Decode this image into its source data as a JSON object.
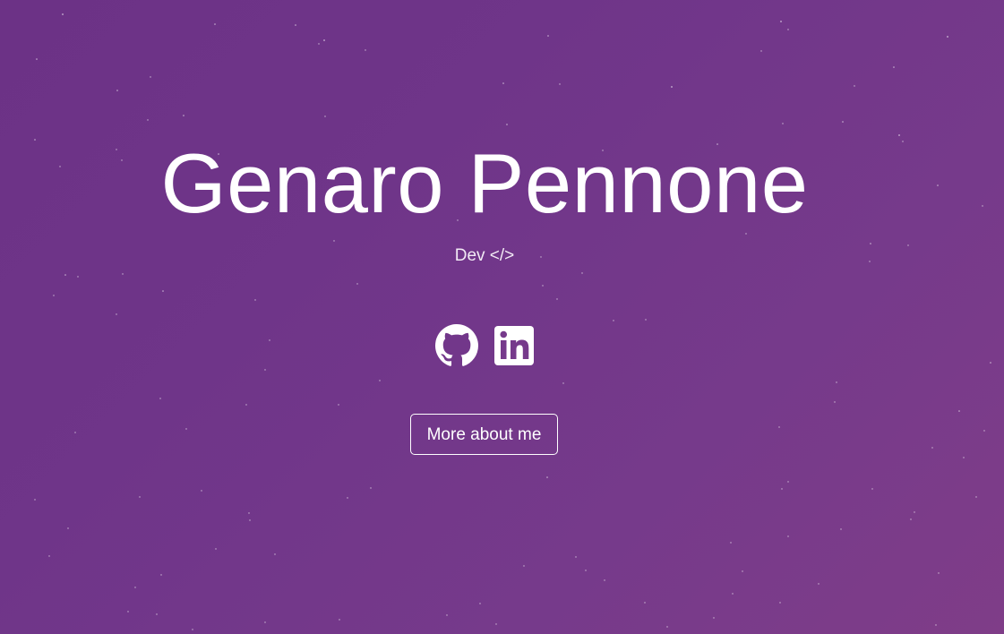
{
  "hero": {
    "name": "Genaro Pennone",
    "tagline": "Dev </>",
    "cta_label": "More about me"
  },
  "socials": [
    {
      "icon": "github-icon"
    },
    {
      "icon": "linkedin-icon"
    }
  ],
  "colors": {
    "background_start": "#6c3286",
    "background_end": "#7f3d88",
    "text": "#ffffff"
  }
}
